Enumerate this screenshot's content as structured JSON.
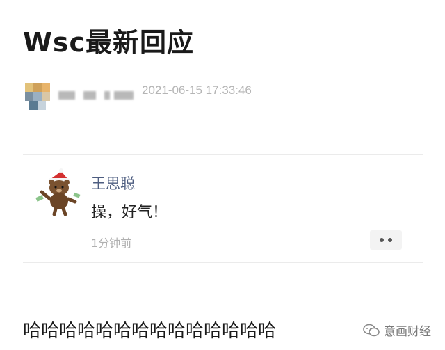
{
  "post": {
    "title": "Wsc最新回应",
    "timestamp": "2021-06-15 17:33:46"
  },
  "comment": {
    "author": "王思聪",
    "text": "操，好气！",
    "time": "1分钟前",
    "more_icon": "more-dots-icon"
  },
  "caption": "哈哈哈哈哈哈哈哈哈哈哈哈哈哈",
  "watermark": {
    "icon": "wechat-icon",
    "text": "意画财经"
  }
}
